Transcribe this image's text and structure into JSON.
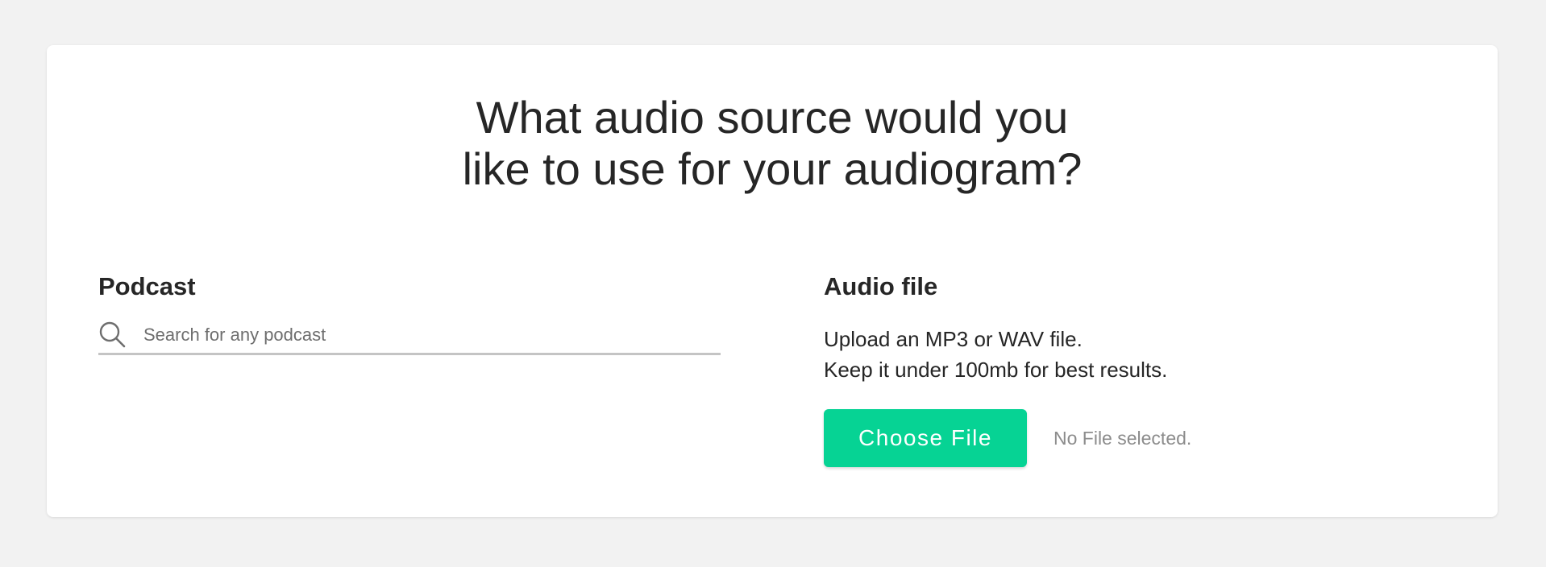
{
  "title": {
    "line1": "What audio source would you",
    "line2": "like to use for your audiogram?"
  },
  "podcast": {
    "heading": "Podcast",
    "search_placeholder": "Search for any podcast",
    "search_value": "",
    "icon": "search-icon"
  },
  "audio_file": {
    "heading": "Audio file",
    "desc_line1": "Upload an MP3 or WAV file.",
    "desc_line2": "Keep it under 100mb for best results.",
    "button_label": "Choose File",
    "status_text": "No File selected."
  },
  "colors": {
    "accent": "#06d394",
    "background": "#f2f2f2",
    "card": "#ffffff",
    "text": "#262626",
    "muted": "#8c8c8c"
  }
}
